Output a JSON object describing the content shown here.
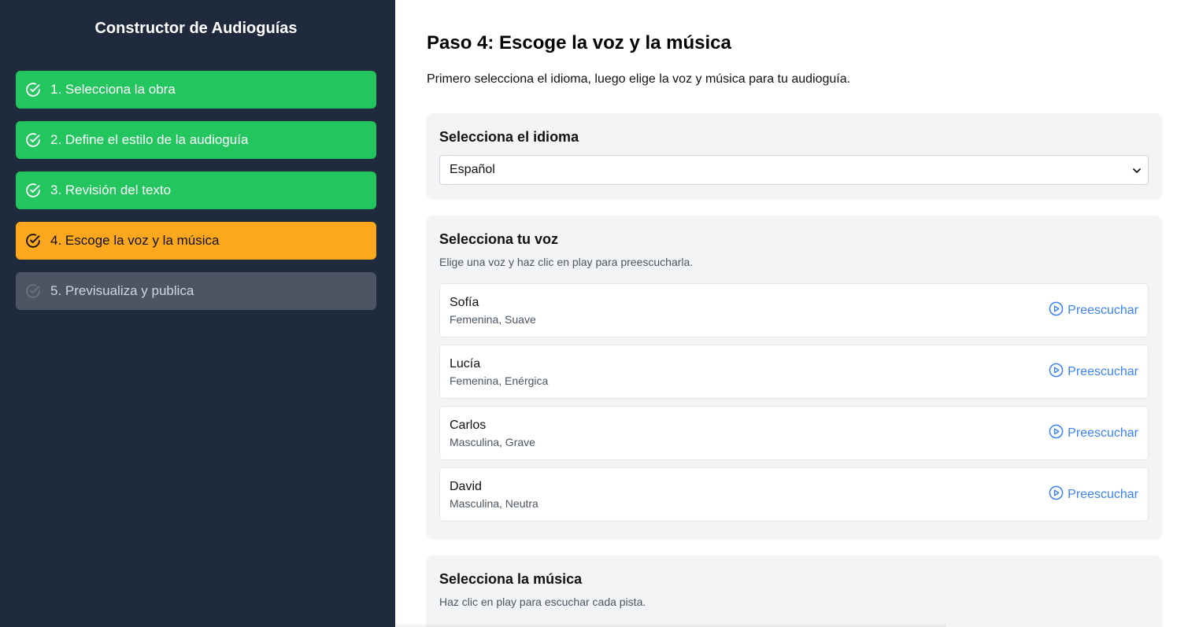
{
  "sidebar": {
    "title": "Constructor de Audioguías",
    "steps": [
      {
        "label": "1. Selecciona la obra",
        "state": "done"
      },
      {
        "label": "2. Define el estilo de la audioguía",
        "state": "done"
      },
      {
        "label": "3. Revisión del texto",
        "state": "done"
      },
      {
        "label": "4. Escoge la voz y la música",
        "state": "active"
      },
      {
        "label": "5. Previsualiza y publica",
        "state": "pending"
      }
    ]
  },
  "main": {
    "title": "Paso 4: Escoge la voz y la música",
    "description": "Primero selecciona el idioma, luego elige la voz y música para tu audioguía.",
    "language": {
      "title": "Selecciona el idioma",
      "selected": "Español"
    },
    "voice": {
      "title": "Selecciona tu voz",
      "subtitle": "Elige una voz y haz clic en play para preescucharla.",
      "preview_label": "Preescuchar",
      "items": [
        {
          "name": "Sofía",
          "desc": "Femenina, Suave"
        },
        {
          "name": "Lucía",
          "desc": "Femenina, Enérgica"
        },
        {
          "name": "Carlos",
          "desc": "Masculina, Grave"
        },
        {
          "name": "David",
          "desc": "Masculina, Neutra"
        }
      ]
    },
    "music": {
      "title": "Selecciona la música",
      "subtitle": "Haz clic en play para escuchar cada pista."
    }
  },
  "colors": {
    "sidebar_bg": "#1f2a3c",
    "done": "#22c55e",
    "active": "#fba81e",
    "pending": "#4b5563",
    "link": "#3b82f6"
  },
  "icons": {
    "step": "check-circle-icon",
    "preview": "play-circle-icon",
    "select": "chevron-down-icon"
  }
}
